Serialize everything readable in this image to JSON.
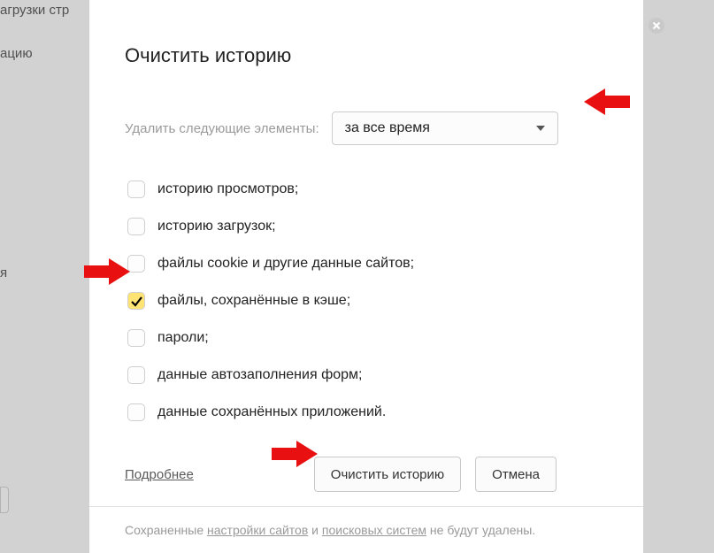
{
  "bg": {
    "t1": "агрузки стр",
    "t2": "ацию",
    "t3": "я"
  },
  "dialog": {
    "title": "Очистить историю",
    "delete_label": "Удалить следующие элементы:",
    "select_value": "за все время",
    "options": {
      "browsing": "историю просмотров;",
      "downloads": "историю загрузок;",
      "cookies": "файлы cookie и другие данные сайтов;",
      "cache": "файлы, сохранённые в кэше;",
      "passwords": "пароли;",
      "autofill": "данные автозаполнения форм;",
      "appdata": "данные сохранённых приложений."
    },
    "more": "Подробнее",
    "primary": "Очистить историю",
    "cancel": "Отмена",
    "footer_pre": "Сохраненные ",
    "footer_l1": "настройки сайтов",
    "footer_mid": " и ",
    "footer_l2": "поисковых систем",
    "footer_post": " не будут удалены."
  }
}
